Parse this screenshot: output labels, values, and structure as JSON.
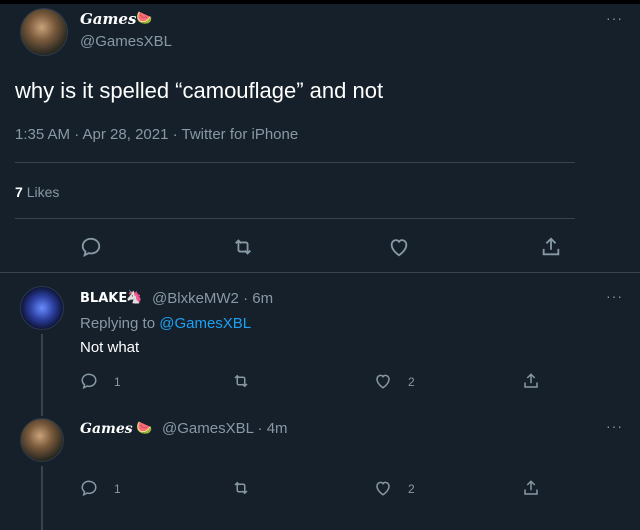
{
  "tweet": {
    "display_name": "Games",
    "name_emoji": "🍉",
    "handle": "@GamesXBL",
    "text": "why is it spelled “camouflage” and not",
    "meta": "1:35 AM · Apr 28, 2021 · Twitter for iPhone",
    "likes_count": "7",
    "likes_label": "Likes",
    "more": "···"
  },
  "replies": [
    {
      "display_name": "BLAKE",
      "badge_emoji": "🦄",
      "handle_time": "@BlxkeMW2 · 6m",
      "replying_prefix": "Replying to",
      "replying_handle": "@GamesXBL",
      "text": "Not what",
      "reply_count": "1",
      "like_count": "2",
      "more": "···"
    },
    {
      "display_name": "Games",
      "badge_emoji": "🍉",
      "handle_time": "@GamesXBL · 4m",
      "reply_count": "1",
      "like_count": "2",
      "more": "···"
    }
  ],
  "icons": {
    "reply": "reply-icon",
    "retweet": "retweet-icon",
    "like": "heart-icon",
    "share": "share-icon"
  }
}
